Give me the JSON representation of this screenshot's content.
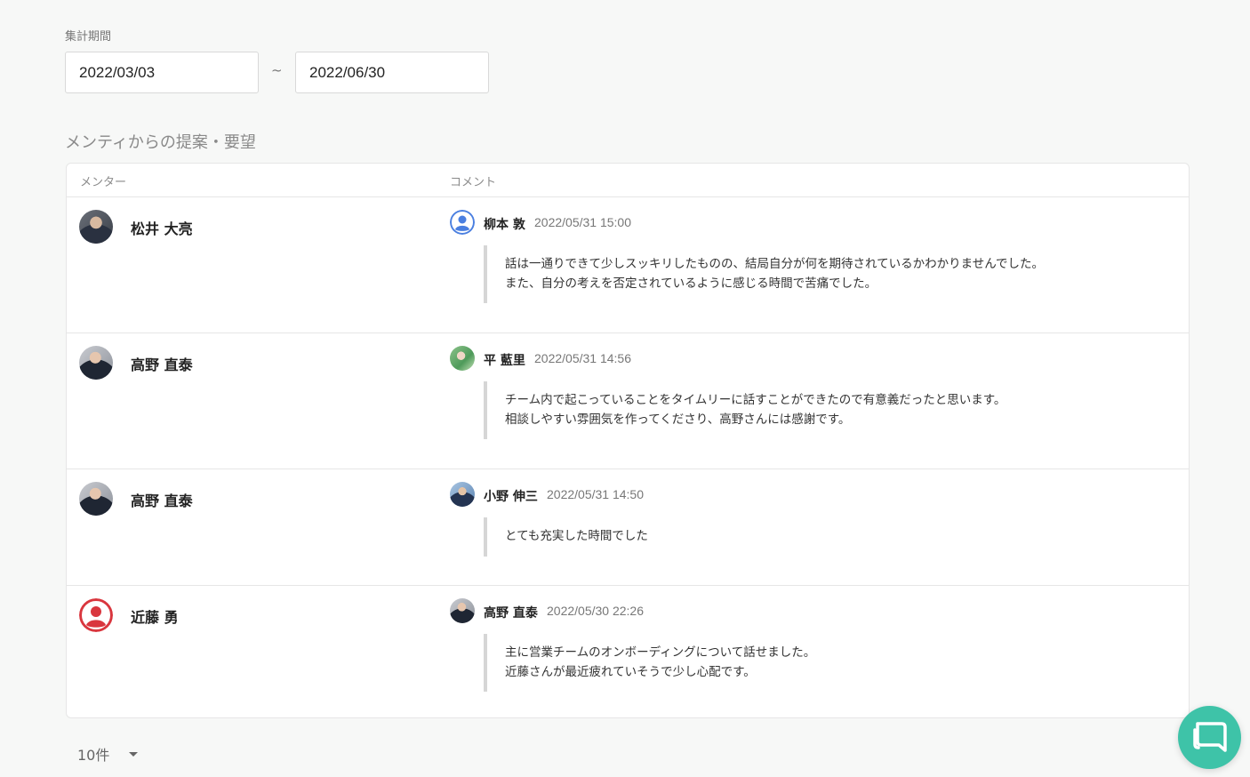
{
  "filter": {
    "period_label": "集計期間",
    "date_from": "2022/03/03",
    "separator": "~",
    "date_to": "2022/06/30"
  },
  "section": {
    "title": "メンティからの提案・要望"
  },
  "table": {
    "headers": {
      "mentor": "メンター",
      "comment": "コメント"
    },
    "rows": [
      {
        "mentor_name": "松井 大亮",
        "mentor_avatar": "photo-avatar",
        "mentee_name": "柳本 敦",
        "mentee_avatar": "default-user-icon",
        "datetime": "2022/05/31 15:00",
        "lines": [
          "話は一通りできて少しスッキリしたものの、結局自分が何を期待されているかわかりませんでした。",
          "また、自分の考えを否定されているように感じる時間で苦痛でした。"
        ]
      },
      {
        "mentor_name": "高野 直泰",
        "mentor_avatar": "photo-avatar",
        "mentee_name": "平 藍里",
        "mentee_avatar": "photo-avatar",
        "datetime": "2022/05/31 14:56",
        "lines": [
          "チーム内で起こっていることをタイムリーに話すことができたので有意義だったと思います。",
          "相談しやすい雰囲気を作ってくださり、高野さんには感謝です。"
        ]
      },
      {
        "mentor_name": "高野 直泰",
        "mentor_avatar": "photo-avatar",
        "mentee_name": "小野 伸三",
        "mentee_avatar": "photo-avatar",
        "datetime": "2022/05/31 14:50",
        "lines": [
          "とても充実した時間でした"
        ]
      },
      {
        "mentor_name": "近藤 勇",
        "mentor_avatar": "default-user-icon",
        "mentee_name": "高野 直泰",
        "mentee_avatar": "photo-avatar",
        "datetime": "2022/05/30 22:26",
        "lines": [
          "主に営業チームのオンボーディングについて話せました。",
          "近藤さんが最近疲れていそうで少し心配です。"
        ]
      }
    ]
  },
  "pagination": {
    "per_page": "10件"
  },
  "colors": {
    "background": "#f7f8f7",
    "chat_button": "#3ec3a8",
    "default_icon_blue": "#4a7fe0",
    "default_icon_red": "#d9363e"
  }
}
